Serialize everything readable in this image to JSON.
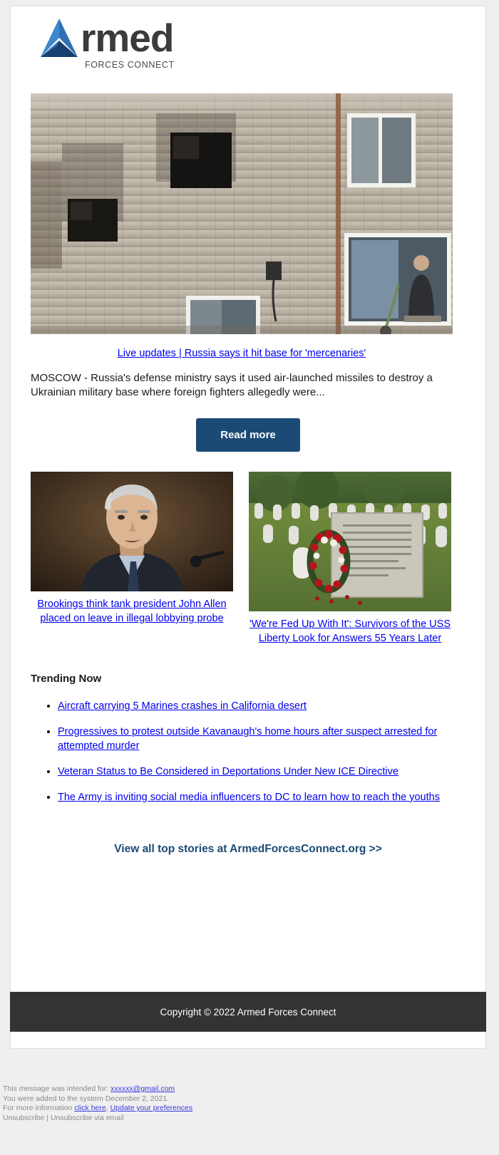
{
  "brand": {
    "logo_word": "rmed",
    "logo_sub": "FORCES CONNECT",
    "logo_icon": "triangle-a-logo",
    "accent_navy": "#1b4a76",
    "link_blue": "#0000ee"
  },
  "hero": {
    "image_alt": "damaged apartment building with blown out windows and a man looking out",
    "headline": "Live updates | Russia says it hit base for 'mercenaries'",
    "body": "MOSCOW - Russia's defense ministry says it used air-launched missiles to destroy a Ukrainian military base where foreign fighters allegedly were...",
    "button_label": "Read more"
  },
  "articles": [
    {
      "image_alt": "portrait of John Allen in a dark suit speaking at a hearing",
      "caption": "Brookings think tank president John Allen placed on leave in illegal lobbying probe"
    },
    {
      "image_alt": "memorial gravestone with red and white wreath at Arlington National Cemetery",
      "caption": "'We're Fed Up With It': Survivors of the USS Liberty Look for Answers 55 Years Later"
    }
  ],
  "trending": {
    "title": "Trending Now",
    "items": [
      "Aircraft carrying 5 Marines crashes in California desert",
      "Progressives to protest outside Kavanaugh's home hours after suspect arrested for attempted murder",
      "Veteran Status to Be Considered in Deportations Under New ICE Directive",
      "The Army is inviting social media influencers to DC to learn how to reach the youths"
    ]
  },
  "cta": {
    "label": "View all top stories at ArmedForcesConnect.org >>"
  },
  "copyright": {
    "text": "Copyright © 2022 Armed Forces Connect"
  },
  "footer": {
    "line1_prefix": "This message was intended for:",
    "line1_email": "xxxxxx@gmail.com",
    "line2": "You were added to the system December 2, 2021.",
    "line3_prefix": "For more information",
    "line3_link1": "click here",
    "line3_sep": ",",
    "line3_link2": "Update your preferences",
    "line4_link": "Unsubscribe",
    "line4_sep": "|",
    "line4_tail": "Unsubscribe via email"
  }
}
